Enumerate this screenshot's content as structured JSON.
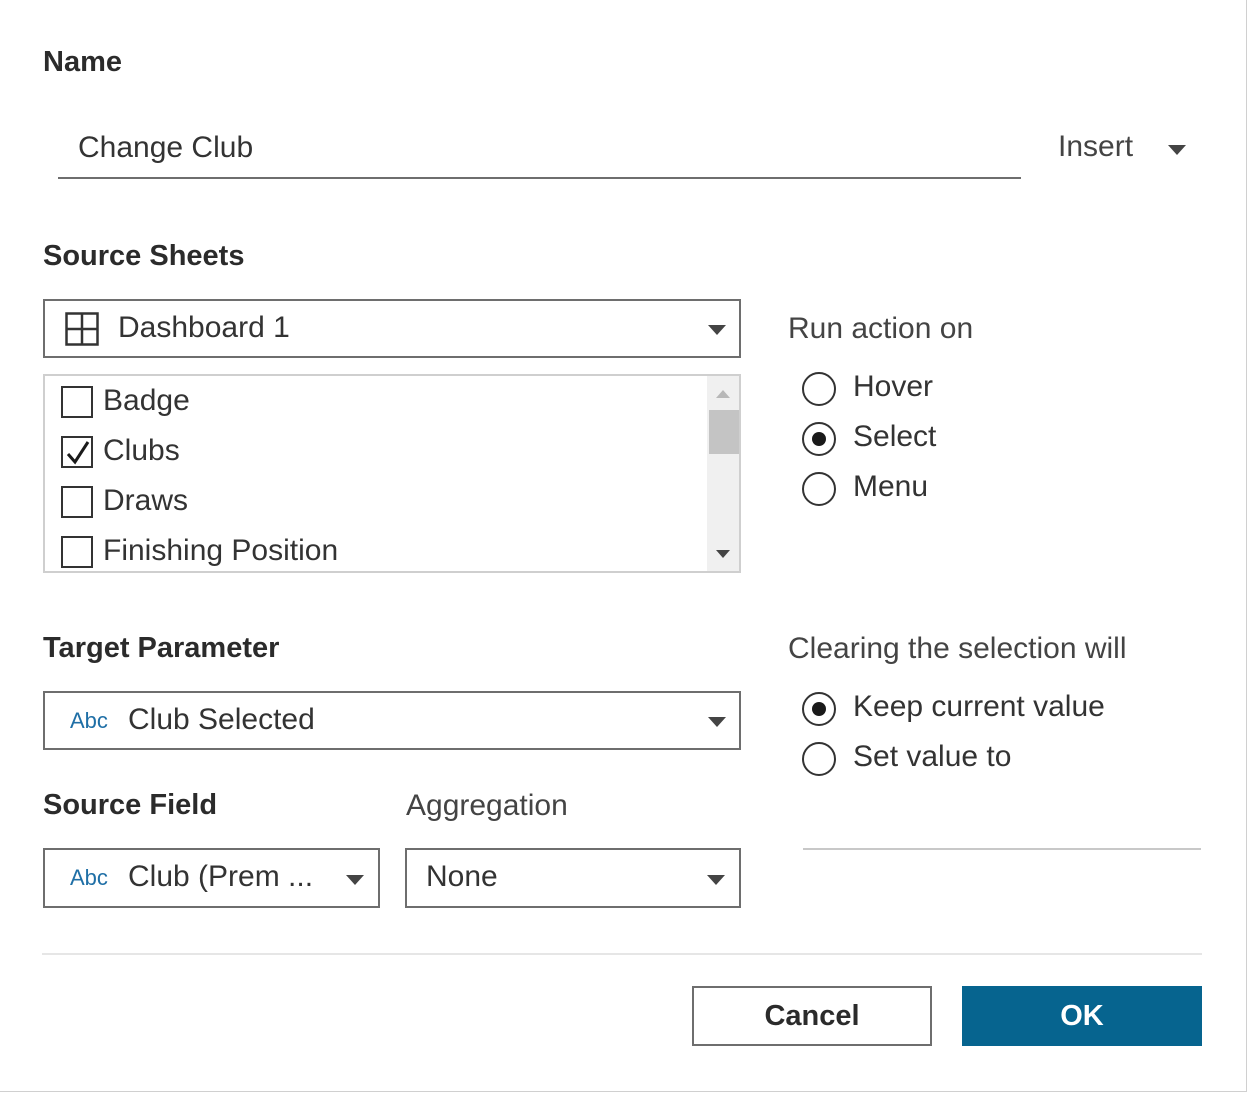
{
  "name_section": {
    "heading": "Name",
    "value": "Change Club",
    "insert_label": "Insert"
  },
  "source_sheets": {
    "heading": "Source Sheets",
    "selected": "Dashboard 1",
    "items": [
      {
        "label": "Badge",
        "checked": false
      },
      {
        "label": "Clubs",
        "checked": true
      },
      {
        "label": "Draws",
        "checked": false
      },
      {
        "label": "Finishing Position",
        "checked": false
      }
    ]
  },
  "run_action": {
    "label": "Run action on",
    "options": [
      {
        "label": "Hover",
        "selected": false
      },
      {
        "label": "Select",
        "selected": true
      },
      {
        "label": "Menu",
        "selected": false
      }
    ]
  },
  "target_parameter": {
    "heading": "Target Parameter",
    "type_badge": "Abc",
    "selected": "Club Selected"
  },
  "clearing": {
    "label": "Clearing the selection will",
    "options": [
      {
        "label": "Keep current value",
        "selected": true
      },
      {
        "label": "Set value to",
        "selected": false
      }
    ]
  },
  "source_field": {
    "heading": "Source Field",
    "type_badge": "Abc",
    "selected": "Club (Prem ..."
  },
  "aggregation": {
    "label": "Aggregation",
    "selected": "None"
  },
  "buttons": {
    "cancel": "Cancel",
    "ok": "OK"
  },
  "colors": {
    "primary": "#06648f",
    "badge": "#1f6fa6"
  }
}
